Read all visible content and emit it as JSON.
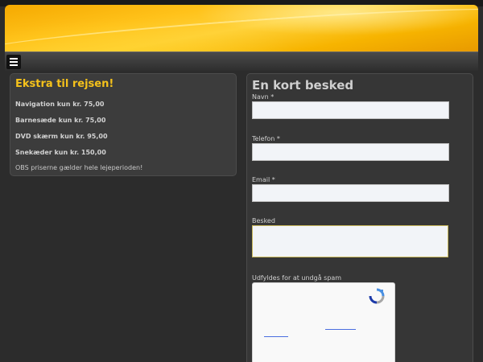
{
  "menu": {
    "icon": "hamburger-menu-icon"
  },
  "extras": {
    "title": "Ekstra til rejsen!",
    "items": [
      "Navigation kun kr. 75,00",
      "Barnesæde kun kr. 75,00",
      "DVD skærm kun kr. 95,00",
      "Snekæder kun kr. 150,00"
    ],
    "note": "OBS priserne gælder hele lejeperioden!"
  },
  "form": {
    "title": "En kort besked",
    "fields": {
      "name_label": "Navn *",
      "phone_label": "Telefon *",
      "email_label": "Email *",
      "message_label": "Besked",
      "spam_label": "Udfyldes for at undgå spam"
    },
    "values": {
      "name": "",
      "phone": "",
      "email": "",
      "message": ""
    }
  },
  "colors": {
    "accent": "#f5c21b",
    "background": "#2c2c2c",
    "panel": "#3a3a3a"
  },
  "recaptcha": {
    "icon": "recaptcha-icon"
  }
}
